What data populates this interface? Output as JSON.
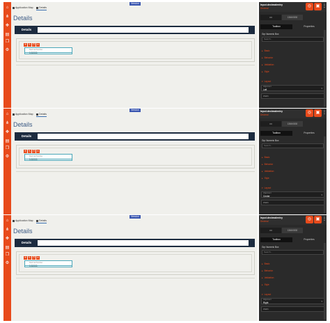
{
  "panels": [
    {
      "breadcrumb": {
        "home": "Application Map",
        "tab": "Details"
      },
      "version_badge": "Version",
      "page_title": "Details",
      "header_bar_label": "Details",
      "field": {
        "label": "Decimal Number",
        "value": "0.00000"
      },
      "properties": {
        "component_name": "Input.decimalentry",
        "component_sub": "Decimal",
        "seg_value": "1366X830",
        "tabs": [
          "Toolbox",
          "Properties"
        ],
        "section": "Grp Numeric Box",
        "search_placeholder": "Search...",
        "groups": [
          "Basic",
          "Behavior",
          "Validation",
          "Style",
          "Layout"
        ],
        "alignment_label": "Alignment",
        "alignment_value": "Left",
        "width_label": "Width"
      }
    },
    {
      "breadcrumb": {
        "home": "Application Map",
        "tab": "Details"
      },
      "version_badge": "Version",
      "page_title": "Details",
      "header_bar_label": "Details",
      "field": {
        "label": "Decimal Number",
        "value": "0.00000"
      },
      "properties": {
        "component_name": "Input.decimalentry",
        "component_sub": "Decimal",
        "seg_value": "1366X830",
        "tabs": [
          "Toolbox",
          "Properties"
        ],
        "section": "Grp Numeric Box",
        "search_placeholder": "Search...",
        "groups": [
          "Basic",
          "Behavior",
          "Validation",
          "Style",
          "Layout"
        ],
        "alignment_label": "Alignment",
        "alignment_value": "Center",
        "width_label": "Width"
      }
    },
    {
      "breadcrumb": {
        "home": "Application Map",
        "tab": "Details"
      },
      "version_badge": "Version",
      "page_title": "Details",
      "header_bar_label": "Details",
      "field": {
        "label": "Decimal Number",
        "value": "0.00000"
      },
      "properties": {
        "component_name": "Input.decimalentry",
        "component_sub": "Decimal",
        "seg_value": "1366X830",
        "tabs": [
          "Toolbox",
          "Properties"
        ],
        "section": "Grp Numeric Box",
        "search_placeholder": "Search...",
        "groups": [
          "Basic",
          "Behavior",
          "Validation",
          "Style",
          "Layout"
        ],
        "alignment_label": "Alignment",
        "alignment_value": "Right",
        "width_label": "Width"
      }
    }
  ],
  "icons": {
    "sidebar": [
      "home-icon",
      "hierarchy-icon",
      "puzzle-icon",
      "layers-icon",
      "copy-icon",
      "settings-icon"
    ],
    "toolbar": [
      "move-icon",
      "edit-icon",
      "copy-icon",
      "delete-icon"
    ],
    "properties_header": [
      "target-icon",
      "save-icon",
      "more-icon"
    ],
    "device": "monitor-icon"
  },
  "colors": {
    "accent": "#e84a1b",
    "navy": "#1c2b3f",
    "panel": "#2a2a2a",
    "canvas": "#f0f0ec"
  }
}
